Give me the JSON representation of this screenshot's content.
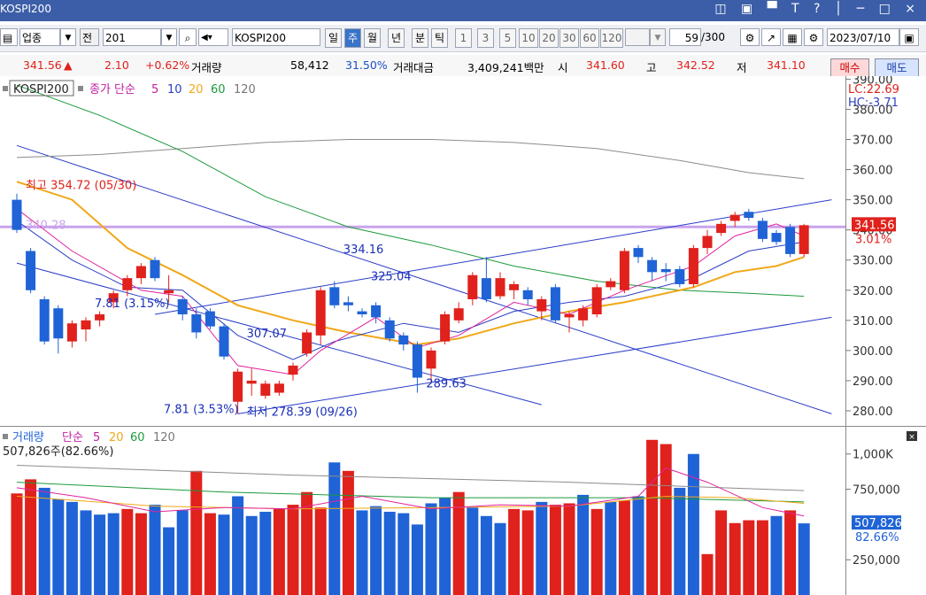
{
  "window": {
    "title": "KOSPI200",
    "controls": "◫ ▣ ▀ T ? │ ─ □ ×"
  },
  "toolbar": {
    "market_select": "업종",
    "market_dropdown": "▼",
    "jeon_label": "전",
    "code_input": "201",
    "code_dropdown": "▼",
    "search_icon": "⌕",
    "sound_icon": "◀▾",
    "index_name": "KOSPI200",
    "period_buttons": [
      "일",
      "주",
      "월",
      "년",
      "분",
      "틱"
    ],
    "active_period": "주",
    "interval_buttons": [
      "1",
      "3",
      "5",
      "10",
      "20",
      "30",
      "60",
      "120"
    ],
    "count_value": "59",
    "count_total": "/300",
    "date_value": "2023/07/10"
  },
  "quote": {
    "price": "341.56",
    "change_arrow": "▲",
    "change": "2.10",
    "change_pct": "+0.62%",
    "volume_label": "거래량",
    "volume": "58,412",
    "volume_ratio": "31.50%",
    "amount_label": "거래대금",
    "amount": "3,409,241백만",
    "open_label": "시",
    "open": "341.60",
    "high_label": "고",
    "high": "342.52",
    "low_label": "저",
    "low": "341.10",
    "buy_label": "매수",
    "sell_label": "매도"
  },
  "chart_data": {
    "type": "candlestick",
    "price_panel": {
      "legend": {
        "symbol": "KOSPI200",
        "ma_prefix": "종가 단순",
        "ma_periods": [
          "5",
          "10",
          "20",
          "60",
          "120"
        ]
      },
      "ma_colors": {
        "5": "#e0249e",
        "10": "#2c3ec2",
        "20": "#f0a818",
        "60": "#1c9a3c",
        "120": "#8c8c8c"
      },
      "up_color": "#e0211c",
      "down_color": "#1f63d6",
      "ylim": [
        275,
        391
      ],
      "yticks": [
        "390.00",
        "380.00",
        "370.00",
        "360.00",
        "350.00",
        "340.00",
        "330.00",
        "320.00",
        "310.00",
        "300.00",
        "290.00",
        "280.00"
      ],
      "ytick_values": [
        390,
        380,
        370,
        360,
        350,
        340,
        330,
        320,
        310,
        300,
        290,
        280
      ],
      "corner_labels": [
        "LC:22.69",
        "HC:-3.71"
      ],
      "candles": [
        {
          "o": 350.0,
          "h": 352.0,
          "l": 339.0,
          "c": 340.0
        },
        {
          "o": 333.0,
          "h": 334.0,
          "l": 319.0,
          "c": 320.0
        },
        {
          "o": 317.0,
          "h": 318.0,
          "l": 302.0,
          "c": 303.0
        },
        {
          "o": 314.0,
          "h": 315.0,
          "l": 299.0,
          "c": 304.0
        },
        {
          "o": 303.0,
          "h": 310.0,
          "l": 301.0,
          "c": 309.0
        },
        {
          "o": 307.0,
          "h": 311.0,
          "l": 303.0,
          "c": 310.0
        },
        {
          "o": 310.0,
          "h": 313.0,
          "l": 308.0,
          "c": 312.0
        },
        {
          "o": 316.0,
          "h": 320.0,
          "l": 314.0,
          "c": 319.0
        },
        {
          "o": 320.0,
          "h": 325.0,
          "l": 318.0,
          "c": 324.0
        },
        {
          "o": 324.0,
          "h": 329.0,
          "l": 322.0,
          "c": 328.0
        },
        {
          "o": 330.0,
          "h": 331.0,
          "l": 323.0,
          "c": 324.0
        },
        {
          "o": 319.0,
          "h": 325.0,
          "l": 316.0,
          "c": 320.0
        },
        {
          "o": 317.0,
          "h": 318.0,
          "l": 310.0,
          "c": 312.0
        },
        {
          "o": 312.0,
          "h": 314.0,
          "l": 304.0,
          "c": 306.0
        },
        {
          "o": 313.0,
          "h": 314.0,
          "l": 307.0,
          "c": 308.0
        },
        {
          "o": 308.0,
          "h": 309.0,
          "l": 297.0,
          "c": 298.0
        },
        {
          "o": 283.0,
          "h": 294.0,
          "l": 279.0,
          "c": 293.0
        },
        {
          "o": 289.0,
          "h": 294.0,
          "l": 285.0,
          "c": 290.0
        },
        {
          "o": 285.0,
          "h": 290.0,
          "l": 284.0,
          "c": 289.0
        },
        {
          "o": 286.0,
          "h": 290.0,
          "l": 285.0,
          "c": 289.0
        },
        {
          "o": 292.0,
          "h": 296.0,
          "l": 290.0,
          "c": 295.0
        },
        {
          "o": 299.0,
          "h": 307.0,
          "l": 298.0,
          "c": 306.0
        },
        {
          "o": 305.0,
          "h": 321.0,
          "l": 302.0,
          "c": 320.0
        },
        {
          "o": 321.0,
          "h": 323.0,
          "l": 314.0,
          "c": 315.0
        },
        {
          "o": 316.0,
          "h": 318.0,
          "l": 313.0,
          "c": 315.0
        },
        {
          "o": 313.0,
          "h": 314.0,
          "l": 311.0,
          "c": 312.0
        },
        {
          "o": 315.0,
          "h": 316.0,
          "l": 309.0,
          "c": 311.0
        },
        {
          "o": 310.0,
          "h": 311.0,
          "l": 303.0,
          "c": 304.0
        },
        {
          "o": 305.0,
          "h": 306.0,
          "l": 300.0,
          "c": 302.0
        },
        {
          "o": 302.0,
          "h": 303.0,
          "l": 286.0,
          "c": 291.0
        },
        {
          "o": 294.0,
          "h": 301.0,
          "l": 289.0,
          "c": 300.0
        },
        {
          "o": 303.0,
          "h": 313.0,
          "l": 302.0,
          "c": 312.0
        },
        {
          "o": 310.0,
          "h": 316.0,
          "l": 309.0,
          "c": 314.0
        },
        {
          "o": 317.0,
          "h": 326.0,
          "l": 315.0,
          "c": 325.0
        },
        {
          "o": 324.0,
          "h": 331.0,
          "l": 316.0,
          "c": 317.0
        },
        {
          "o": 318.0,
          "h": 326.0,
          "l": 317.0,
          "c": 324.0
        },
        {
          "o": 320.0,
          "h": 323.0,
          "l": 317.0,
          "c": 322.0
        },
        {
          "o": 320.0,
          "h": 321.0,
          "l": 315.0,
          "c": 317.0
        },
        {
          "o": 313.0,
          "h": 318.0,
          "l": 310.0,
          "c": 317.0
        },
        {
          "o": 321.0,
          "h": 322.0,
          "l": 309.0,
          "c": 310.0
        },
        {
          "o": 311.0,
          "h": 313.0,
          "l": 306.0,
          "c": 312.0
        },
        {
          "o": 310.0,
          "h": 315.0,
          "l": 308.0,
          "c": 314.0
        },
        {
          "o": 312.0,
          "h": 322.0,
          "l": 311.0,
          "c": 321.0
        },
        {
          "o": 321.0,
          "h": 324.0,
          "l": 320.0,
          "c": 323.0
        },
        {
          "o": 320.0,
          "h": 334.0,
          "l": 319.0,
          "c": 333.0
        },
        {
          "o": 334.0,
          "h": 335.0,
          "l": 329.0,
          "c": 331.0
        },
        {
          "o": 330.0,
          "h": 331.0,
          "l": 323.0,
          "c": 326.0
        },
        {
          "o": 327.0,
          "h": 329.0,
          "l": 323.0,
          "c": 326.0
        },
        {
          "o": 327.0,
          "h": 328.0,
          "l": 321.0,
          "c": 322.0
        },
        {
          "o": 322.0,
          "h": 335.0,
          "l": 321.0,
          "c": 334.0
        },
        {
          "o": 334.0,
          "h": 340.0,
          "l": 332.0,
          "c": 338.0
        },
        {
          "o": 339.0,
          "h": 343.0,
          "l": 338.0,
          "c": 342.0
        },
        {
          "o": 343.0,
          "h": 346.0,
          "l": 341.0,
          "c": 345.0
        },
        {
          "o": 346.0,
          "h": 347.0,
          "l": 343.0,
          "c": 344.0
        },
        {
          "o": 343.0,
          "h": 344.0,
          "l": 336.0,
          "c": 337.0
        },
        {
          "o": 339.0,
          "h": 340.0,
          "l": 335.0,
          "c": 336.0
        },
        {
          "o": 341.0,
          "h": 342.0,
          "l": 331.0,
          "c": 332.0
        },
        {
          "o": 332.0,
          "h": 342.0,
          "l": 331.0,
          "c": 341.56
        }
      ],
      "ma5": [
        [
          0,
          347
        ],
        [
          4,
          333
        ],
        [
          9,
          320
        ],
        [
          12,
          318
        ],
        [
          16,
          295
        ],
        [
          20,
          292
        ],
        [
          22,
          300
        ],
        [
          26,
          311
        ],
        [
          29,
          301
        ],
        [
          32,
          305
        ],
        [
          36,
          316
        ],
        [
          40,
          312
        ],
        [
          44,
          320
        ],
        [
          49,
          328
        ],
        [
          52,
          338
        ],
        [
          55,
          342
        ],
        [
          57,
          338
        ]
      ],
      "ma10": [
        [
          0,
          343
        ],
        [
          4,
          330
        ],
        [
          8,
          321
        ],
        [
          12,
          320
        ],
        [
          16,
          305
        ],
        [
          20,
          297
        ],
        [
          23,
          303
        ],
        [
          28,
          309
        ],
        [
          32,
          306
        ],
        [
          36,
          313
        ],
        [
          40,
          316
        ],
        [
          44,
          318
        ],
        [
          49,
          324
        ],
        [
          53,
          333
        ],
        [
          57,
          336
        ]
      ],
      "ma20": [
        [
          0,
          356
        ],
        [
          4,
          350
        ],
        [
          8,
          334
        ],
        [
          12,
          325
        ],
        [
          16,
          315
        ],
        [
          20,
          310
        ],
        [
          24,
          306
        ],
        [
          29,
          302
        ],
        [
          32,
          304
        ],
        [
          36,
          309
        ],
        [
          40,
          313
        ],
        [
          44,
          316
        ],
        [
          49,
          321
        ],
        [
          52,
          326
        ],
        [
          55,
          328
        ],
        [
          57,
          331
        ]
      ],
      "ma60": [
        [
          0,
          388
        ],
        [
          6,
          378
        ],
        [
          12,
          366
        ],
        [
          18,
          351
        ],
        [
          24,
          341
        ],
        [
          30,
          335
        ],
        [
          36,
          328
        ],
        [
          42,
          323
        ],
        [
          48,
          320
        ],
        [
          53,
          319
        ],
        [
          57,
          318
        ]
      ],
      "ma120": [
        [
          0,
          364
        ],
        [
          6,
          365
        ],
        [
          12,
          367
        ],
        [
          18,
          369
        ],
        [
          24,
          370
        ],
        [
          30,
          370
        ],
        [
          36,
          369
        ],
        [
          42,
          367
        ],
        [
          48,
          363
        ],
        [
          53,
          359
        ],
        [
          57,
          357
        ]
      ],
      "trendlines": [
        [
          [
            0,
            368
          ],
          [
            59,
            279
          ]
        ],
        [
          [
            0,
            329
          ],
          [
            38,
            282
          ]
        ],
        [
          [
            16,
            279
          ],
          [
            59,
            311
          ]
        ],
        [
          [
            10,
            312
          ],
          [
            59,
            350
          ]
        ]
      ],
      "hline": {
        "value": 341.0,
        "color": "#c9a3ec"
      },
      "annotations": [
        {
          "label": "최고 354.72 (05/30)",
          "x": 0,
          "y": 354.72,
          "color": "#e0211c"
        },
        {
          "label": "최저 278.39 (09/26)",
          "x": 16,
          "y": 279.5,
          "color": "#1a2fb8"
        },
        {
          "label": "7.81 (3.15%)",
          "x": 5,
          "y": 315.5,
          "color": "#1a2fb8"
        },
        {
          "label": "7.81 (3.53%)",
          "x": 10,
          "y": 280.5,
          "color": "#1a2fb8"
        },
        {
          "label": "334.16",
          "x": 23,
          "y": 333.5,
          "color": "#1a2fb8"
        },
        {
          "label": "325.04",
          "x": 25,
          "y": 324.5,
          "color": "#1a2fb8"
        },
        {
          "label": "307.07",
          "x": 16,
          "y": 305.5,
          "color": "#1a2fb8"
        },
        {
          "label": "289.63",
          "x": 29,
          "y": 289.0,
          "color": "#1a2fb8"
        },
        {
          "label": "340.28",
          "x": 0,
          "y": 341.5,
          "color": "#c9a3ec"
        }
      ],
      "last_price_label": "341.56",
      "last_price_pct": "3.01%"
    },
    "volume_panel": {
      "legend": {
        "name": "거래량",
        "ma_prefix": "단순",
        "ma_periods": [
          "5",
          "20",
          "60",
          "120"
        ]
      },
      "current_label": "507,826주(82.66%)",
      "ylim": [
        0,
        1130000
      ],
      "yticks": [
        "1,000K",
        "750,000",
        "250,000"
      ],
      "ytick_values": [
        1000000,
        750000,
        250000
      ],
      "last_value_label": "507,826",
      "last_value_pct": "82.66%",
      "volumes": [
        720000,
        820000,
        760000,
        680000,
        660000,
        600000,
        570000,
        580000,
        610000,
        580000,
        640000,
        480000,
        600000,
        880000,
        580000,
        570000,
        700000,
        560000,
        590000,
        610000,
        640000,
        730000,
        620000,
        940000,
        880000,
        600000,
        630000,
        590000,
        580000,
        500000,
        650000,
        690000,
        730000,
        620000,
        560000,
        510000,
        610000,
        600000,
        660000,
        640000,
        650000,
        710000,
        610000,
        660000,
        670000,
        700000,
        1100000,
        1070000,
        760000,
        1000000,
        290000,
        600000,
        510000,
        530000,
        530000,
        560000,
        600000,
        507826
      ],
      "up": [
        true,
        true,
        false,
        false,
        false,
        false,
        false,
        false,
        true,
        true,
        false,
        false,
        false,
        true,
        true,
        false,
        false,
        false,
        false,
        true,
        true,
        true,
        true,
        false,
        true,
        false,
        false,
        false,
        false,
        false,
        false,
        false,
        true,
        false,
        false,
        false,
        true,
        true,
        false,
        true,
        true,
        false,
        true,
        false,
        true,
        false,
        true,
        true,
        false,
        false,
        true,
        true,
        true,
        true,
        true,
        false,
        true,
        false
      ],
      "ma5": [
        [
          0,
          760000
        ],
        [
          5,
          690000
        ],
        [
          10,
          590000
        ],
        [
          15,
          620000
        ],
        [
          20,
          610000
        ],
        [
          25,
          700000
        ],
        [
          30,
          610000
        ],
        [
          35,
          640000
        ],
        [
          40,
          630000
        ],
        [
          45,
          700000
        ],
        [
          47,
          900000
        ],
        [
          50,
          800000
        ],
        [
          54,
          620000
        ],
        [
          57,
          560000
        ]
      ],
      "ma20": [
        [
          0,
          700000
        ],
        [
          10,
          630000
        ],
        [
          20,
          610000
        ],
        [
          30,
          620000
        ],
        [
          40,
          630000
        ],
        [
          47,
          700000
        ],
        [
          52,
          690000
        ],
        [
          57,
          650000
        ]
      ],
      "ma60": [
        [
          0,
          800000
        ],
        [
          15,
          730000
        ],
        [
          30,
          690000
        ],
        [
          45,
          690000
        ],
        [
          57,
          660000
        ]
      ],
      "ma120": [
        [
          0,
          920000
        ],
        [
          20,
          850000
        ],
        [
          40,
          800000
        ],
        [
          57,
          740000
        ]
      ]
    }
  }
}
